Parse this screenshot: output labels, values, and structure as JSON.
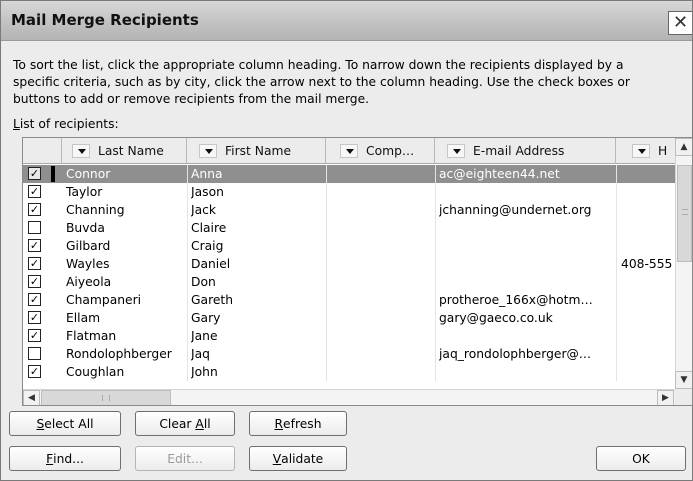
{
  "window": {
    "title": "Mail Merge Recipients",
    "close_glyph": "✕"
  },
  "instructions": {
    "line1": "To sort the list, click the appropriate column heading.  To narrow down the recipients displayed by a",
    "line2": "specific criteria, such as by city, click the arrow next to the column heading.  Use the check boxes or",
    "line3": "buttons to add or remove recipients from the mail merge."
  },
  "list_label": {
    "accel": "L",
    "rest": "ist of recipients:"
  },
  "columns": {
    "last_name": "Last Name",
    "first_name": "First Name",
    "company": "Comp…",
    "email": "E-mail Address",
    "h": "H"
  },
  "rows": [
    {
      "checked": true,
      "last": "Connor",
      "first": "Anna",
      "company": "",
      "email": "ac@eighteen44.net",
      "h": "",
      "selected": true
    },
    {
      "checked": true,
      "last": "Taylor",
      "first": "Jason",
      "company": "",
      "email": "",
      "h": ""
    },
    {
      "checked": true,
      "last": "Channing",
      "first": "Jack",
      "company": "",
      "email": "jchanning@undernet.org",
      "h": ""
    },
    {
      "checked": false,
      "last": "Buvda",
      "first": "Claire",
      "company": "",
      "email": "",
      "h": ""
    },
    {
      "checked": true,
      "last": "Gilbard",
      "first": "Craig",
      "company": "",
      "email": "",
      "h": ""
    },
    {
      "checked": true,
      "last": "Wayles",
      "first": "Daniel",
      "company": "",
      "email": "",
      "h": "408-555"
    },
    {
      "checked": true,
      "last": "Aiyeola",
      "first": "Don",
      "company": "",
      "email": "",
      "h": ""
    },
    {
      "checked": true,
      "last": "Champaneri",
      "first": "Gareth",
      "company": "",
      "email": "protheroe_166x@hotm…",
      "h": ""
    },
    {
      "checked": true,
      "last": "Ellam",
      "first": "Gary",
      "company": "",
      "email": "gary@gaeco.co.uk",
      "h": ""
    },
    {
      "checked": true,
      "last": "Flatman",
      "first": "Jane",
      "company": "",
      "email": "",
      "h": ""
    },
    {
      "checked": false,
      "last": "Rondolophberger",
      "first": "Jaq",
      "company": "",
      "email": "jaq_rondolophberger@…",
      "h": ""
    },
    {
      "checked": true,
      "last": "Coughlan",
      "first": "John",
      "company": "",
      "email": "",
      "h": ""
    }
  ],
  "buttons": {
    "select_all": {
      "accel": "S",
      "rest": "elect All"
    },
    "clear_all": {
      "pre": "Clear ",
      "accel": "A",
      "rest": "ll"
    },
    "refresh": {
      "accel": "R",
      "rest": "efresh"
    },
    "find": {
      "accel": "F",
      "rest": "ind..."
    },
    "edit": "Edit...",
    "validate": {
      "accel": "V",
      "rest": "alidate"
    },
    "ok": "OK"
  },
  "colors": {
    "selected_row": "#8f8f8f",
    "dialog_bg": "#ececec"
  }
}
